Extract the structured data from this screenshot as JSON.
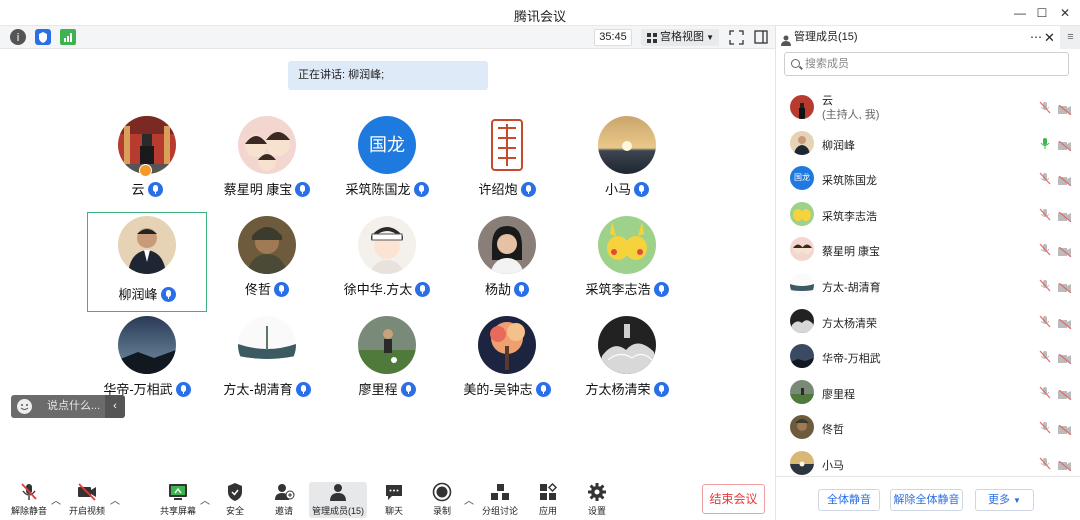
{
  "window": {
    "title": "腾讯会议",
    "minimize": "—",
    "maximize": "☐",
    "close": "✕"
  },
  "topbar": {
    "timer": "35:45",
    "view_label": "宫格视图"
  },
  "speaking": "正在讲话: 柳润峰;",
  "tiles": [
    {
      "name": "云",
      "avatar": "photo",
      "host": true
    },
    {
      "name": "蔡星明 康宝",
      "avatar": "cartoon-family"
    },
    {
      "name": "采筑陈国龙",
      "avatar": "text",
      "avatar_text": "国龙",
      "avatar_color": "#1f7ae0"
    },
    {
      "name": "许绍炮",
      "avatar": "seal"
    },
    {
      "name": "小马",
      "avatar": "sunset"
    },
    {
      "name": "柳润峰",
      "avatar": "man-suit",
      "active": true
    },
    {
      "name": "佟哲",
      "avatar": "warrior"
    },
    {
      "name": "徐中华.方太",
      "avatar": "girl-cartoon"
    },
    {
      "name": "杨劼",
      "avatar": "woman"
    },
    {
      "name": "采筑李志浩",
      "avatar": "pikachu"
    },
    {
      "name": "华帝-万相武",
      "avatar": "night-sky"
    },
    {
      "name": "方太-胡清育",
      "avatar": "landscape"
    },
    {
      "name": "廖里程",
      "avatar": "football"
    },
    {
      "name": "美的-吴钟志",
      "avatar": "tree"
    },
    {
      "name": "方太杨清荣",
      "avatar": "ink"
    }
  ],
  "chat_placeholder": "说点什么...",
  "bottombar": {
    "unmute": "解除静音",
    "start_video": "开启视频",
    "share_screen": "共享屏幕",
    "security": "安全",
    "invite": "邀请",
    "members": "管理成员(15)",
    "chat": "聊天",
    "record": "录制",
    "breakout": "分组讨论",
    "apps": "应用",
    "settings": "设置",
    "end": "结束会议"
  },
  "panel": {
    "title": "管理成员(15)",
    "search_placeholder": "搜索成员",
    "members": [
      {
        "name": "云",
        "sub": "(主持人, 我)",
        "mic": "muted",
        "avatar": "photo"
      },
      {
        "name": "柳润峰",
        "mic": "on",
        "avatar": "man-suit"
      },
      {
        "name": "采筑陈国龙",
        "mic": "muted",
        "avatar": "text",
        "avatar_text": "国龙"
      },
      {
        "name": "采筑李志浩",
        "mic": "muted",
        "avatar": "pikachu"
      },
      {
        "name": "蔡星明 康宝",
        "mic": "muted",
        "avatar": "cartoon-family"
      },
      {
        "name": "方太-胡清育",
        "mic": "muted",
        "avatar": "landscape"
      },
      {
        "name": "方太杨清荣",
        "mic": "muted",
        "avatar": "ink"
      },
      {
        "name": "华帝-万相武",
        "mic": "muted",
        "avatar": "night-sky"
      },
      {
        "name": "廖里程",
        "mic": "muted",
        "avatar": "football"
      },
      {
        "name": "佟哲",
        "mic": "muted",
        "avatar": "warrior"
      },
      {
        "name": "小马",
        "mic": "muted",
        "avatar": "sunset"
      }
    ],
    "mute_all": "全体静音",
    "unmute_all": "解除全体静音",
    "more": "更多"
  },
  "colors": {
    "accent": "#2a6fe6",
    "active_border": "#3fb27f",
    "danger": "#e23a3a"
  }
}
